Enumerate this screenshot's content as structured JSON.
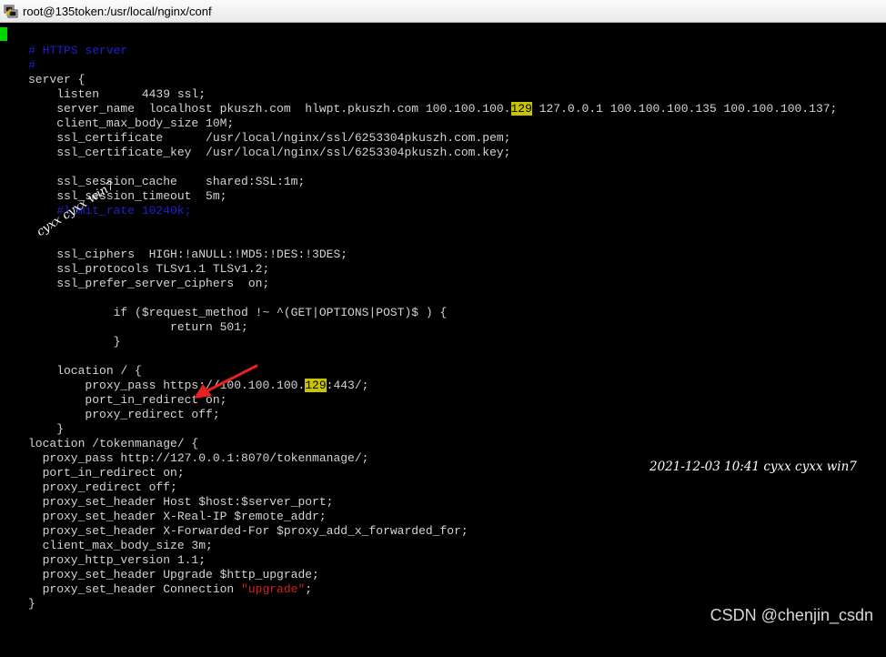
{
  "window": {
    "title": "root@135token:/usr/local/nginx/conf",
    "icon": "putty-terminal-icon"
  },
  "colors": {
    "background": "#000000",
    "text": "#d4d4d4",
    "comment": "#2020cc",
    "string": "#d21f1f",
    "highlight": "#c9c400",
    "cursor": "#00d800",
    "annotation_arrow": "#e8201e"
  },
  "code": {
    "l01": "# HTTPS server",
    "l02": "#",
    "l03": "server {",
    "l04": "    listen      4439 ssl;",
    "l05a": "    server_name  localhost pkuszh.com  hlwpt.pkuszh.com 100.100.100.",
    "l05hl": "129",
    "l05b": " 127.0.0.1 100.100.100.135 100.100.100.137;",
    "l06": "    client_max_body_size 10M;",
    "l07": "    ssl_certificate      /usr/local/nginx/ssl/6253304pkuszh.com.pem;",
    "l08": "    ssl_certificate_key  /usr/local/nginx/ssl/6253304pkuszh.com.key;",
    "l09": "    ssl_session_cache    shared:SSL:1m;",
    "l10": "    ssl_session_timeout  5m;",
    "l11": "    #limit_rate 10240k;",
    "l12": "    ssl_ciphers  HIGH:!aNULL:!MD5:!DES:!3DES;",
    "l13": "    ssl_protocols TLSv1.1 TLSv1.2;",
    "l14": "    ssl_prefer_server_ciphers  on;",
    "l15": "            if ($request_method !~ ^(GET|OPTIONS|POST)$ ) {",
    "l16": "                    return 501;",
    "l17": "            }",
    "l18": "    location / {",
    "l19a": "        proxy_pass https://100.100.100.",
    "l19hl": "129",
    "l19b": ":443/;",
    "l20": "        port_in_redirect on;",
    "l21": "        proxy_redirect off;",
    "l22": "    }",
    "l23": "location /tokenmanage/ {",
    "l24": "  proxy_pass http://127.0.0.1:8070/tokenmanage/;",
    "l25": "  port_in_redirect on;",
    "l26": "  proxy_redirect off;",
    "l27": "  proxy_set_header Host $host:$server_port;",
    "l28": "  proxy_set_header X-Real-IP $remote_addr;",
    "l29": "  proxy_set_header X-Forwarded-For $proxy_add_x_forwarded_for;",
    "l30": "  client_max_body_size 3m;",
    "l31": "  proxy_http_version 1.1;",
    "l32": "  proxy_set_header Upgrade $http_upgrade;",
    "l33a": "  proxy_set_header Connection ",
    "l33s": "\"upgrade\"",
    "l33b": ";",
    "l34": "}"
  },
  "watermarks": {
    "diagonal": "cyxx cyxx win7",
    "timestamp": "2021-12-03 10:41 cyxx cyxx win7",
    "csdn": "CSDN @chenjin_csdn"
  }
}
